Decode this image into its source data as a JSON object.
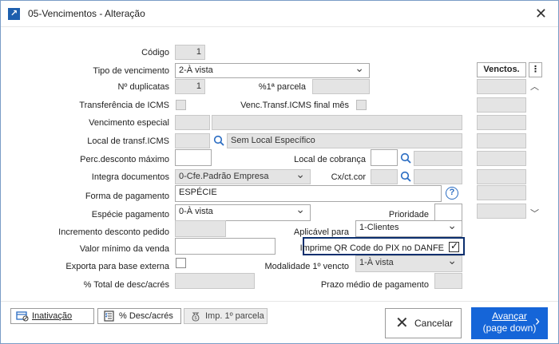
{
  "window": {
    "title": "05-Vencimentos - Alteração",
    "close_glyph": "✕"
  },
  "form": {
    "codigo": {
      "label": "Código",
      "value": "1"
    },
    "tipo_vencimento": {
      "label": "Tipo de vencimento",
      "value": "2-À vista"
    },
    "n_duplicatas": {
      "label": "Nº duplicatas",
      "value": "1"
    },
    "pct_1a_parcela": {
      "label": "%1ª parcela",
      "value": ""
    },
    "transf_icms": {
      "label": "Transferência de ICMS"
    },
    "venc_transf_icms": {
      "label": "Venc.Transf.ICMS final mês"
    },
    "vencimento_especial": {
      "label": "Vencimento especial"
    },
    "local_transf_icms": {
      "label": "Local de transf.ICMS",
      "value": "Sem Local Específico"
    },
    "perc_desc_max": {
      "label": "Perc.desconto máximo"
    },
    "local_cobranca": {
      "label": "Local de cobrança"
    },
    "integra_documentos": {
      "label": "Integra documentos",
      "value": "0-Cfe.Padrão Empresa"
    },
    "cx_ct_cor": {
      "label": "Cx/ct.cor"
    },
    "forma_pagamento": {
      "label": "Forma de pagamento",
      "value": "ESPÉCIE"
    },
    "especie_pagamento": {
      "label": "Espécie pagamento",
      "value": "0-À vista"
    },
    "prioridade": {
      "label": "Prioridade"
    },
    "incremento_desconto": {
      "label": "Incremento desconto pedido"
    },
    "aplicavel_para": {
      "label": "Aplicável para",
      "value": "1-Clientes"
    },
    "valor_minimo": {
      "label": "Valor mínimo da venda"
    },
    "imprime_qr": {
      "label": "Imprime QR Code do PIX no DANFE",
      "checked": true
    },
    "exporta_base": {
      "label": "Exporta para base externa"
    },
    "modalidade": {
      "label": "Modalidade 1º vencto",
      "value": "1-À vista"
    },
    "pct_total_desc": {
      "label": "% Total de desc/acrés"
    },
    "prazo_medio": {
      "label": "Prazo médio de pagamento"
    }
  },
  "side": {
    "header": "Venctos.",
    "menu_glyph": "⋮"
  },
  "buttons": {
    "inativacao": "Inativação",
    "desc_acres": "% Desc/acrés",
    "imp_parcela": "Imp. 1º parcela",
    "cancelar": "Cancelar",
    "avancar": "Avançar",
    "avancar_sub": "(page down)"
  },
  "colors": {
    "accent": "#1565d8",
    "highlight_border": "#0b2f6e",
    "icon_blue": "#2a6cc2"
  }
}
